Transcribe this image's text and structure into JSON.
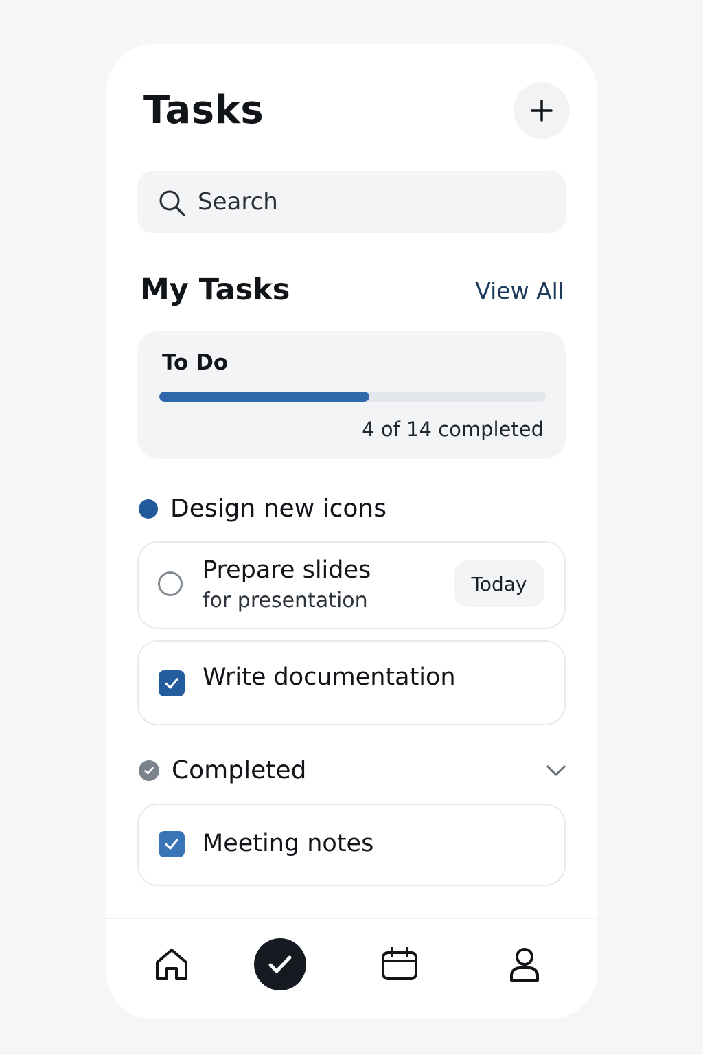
{
  "header": {
    "title": "Tasks",
    "add_icon": "plus-icon"
  },
  "search": {
    "placeholder": "Search",
    "icon": "search-icon"
  },
  "my_tasks": {
    "title": "My Tasks",
    "view_all_label": "View All"
  },
  "progress": {
    "title": "To Do",
    "completed": 4,
    "total": 14,
    "fill_fraction": 0.544,
    "label": "4 of 14 completed",
    "fill_color": "#2f68ab",
    "track_color": "#e3e6ea"
  },
  "groups": [
    {
      "label": "Design new icons",
      "dot_color": "#21599b",
      "tasks": [
        {
          "title": "Prepare slides",
          "subtitle": "for presentation",
          "checked": false,
          "due": "Today"
        },
        {
          "title": "Write documentation",
          "checked": true
        }
      ]
    },
    {
      "label": "Completed",
      "icon": "check-circle-icon",
      "collapse_icon": "chevron-down-icon",
      "tasks": [
        {
          "title": "Meeting notes",
          "checked": true
        }
      ]
    }
  ],
  "tab_bar": {
    "tabs": [
      {
        "name": "home",
        "icon": "home-icon",
        "active": false
      },
      {
        "name": "tasks",
        "icon": "check-icon",
        "active": true
      },
      {
        "name": "calendar",
        "icon": "calendar-icon",
        "active": false
      },
      {
        "name": "profile",
        "icon": "user-icon",
        "active": false
      }
    ]
  },
  "colors": {
    "accent": "#245d9d",
    "text": "#111418",
    "background": "#f6f6f6",
    "card": "#ffffff",
    "surface": "#f3f4f6",
    "active_tab": "#151a21"
  }
}
